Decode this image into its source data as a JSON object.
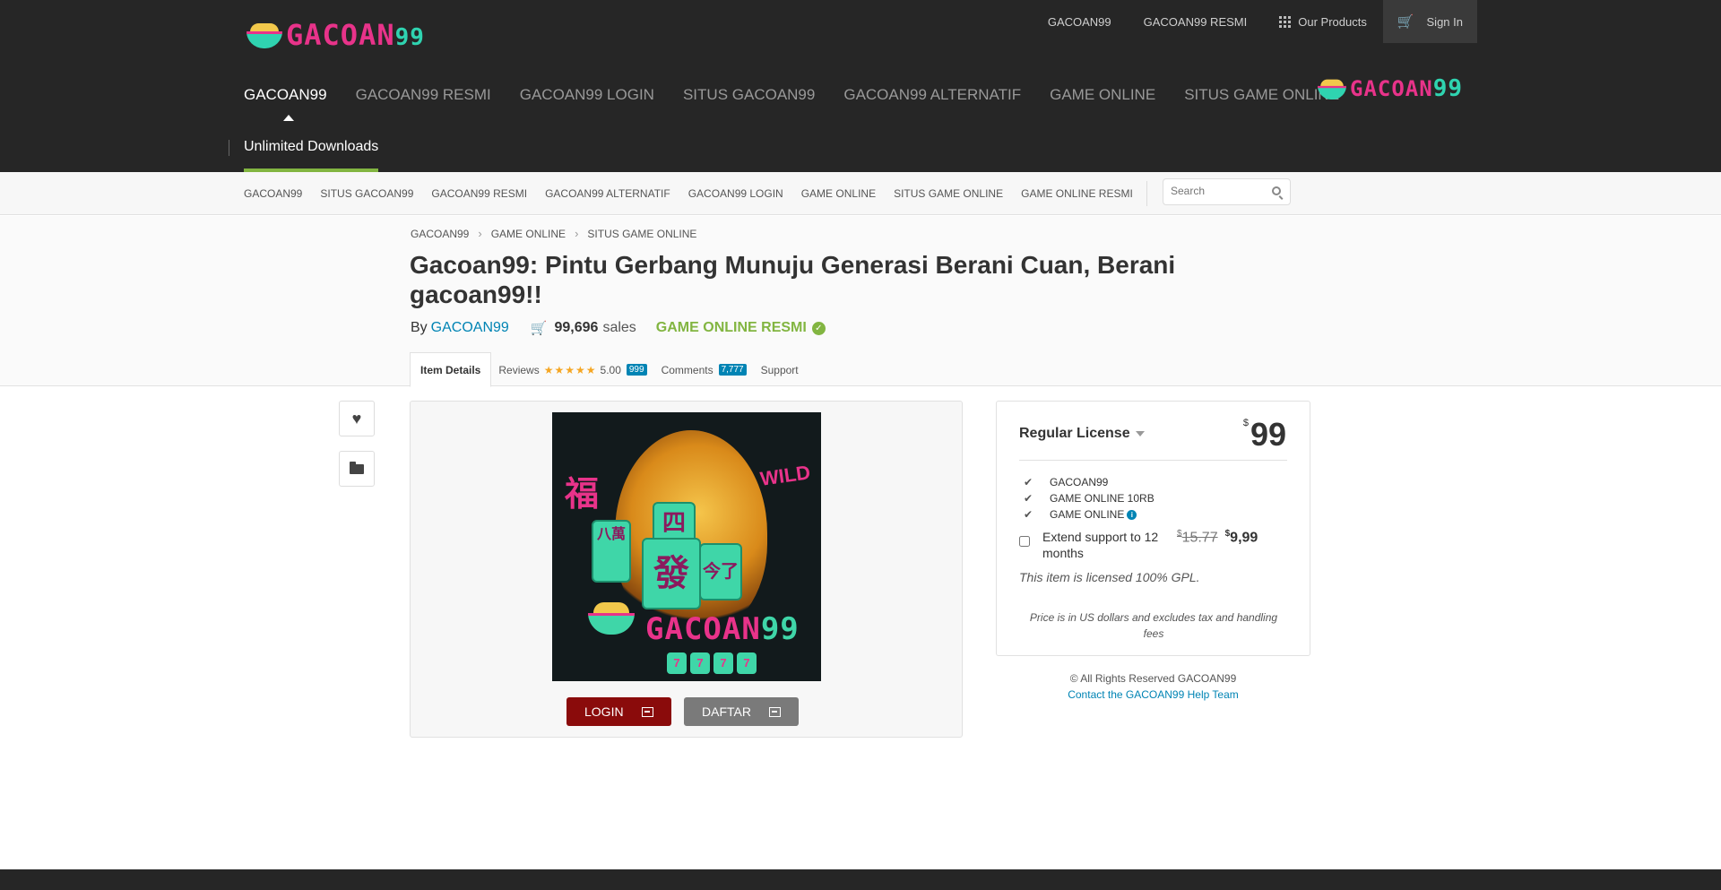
{
  "brand": {
    "logo_main": "GACOAN",
    "logo_num": "99",
    "accent": "#e8338a",
    "teal": "#2fd3b0",
    "green": "#82b541",
    "link_blue": "#0084b4"
  },
  "top_links": [
    "GACOAN99",
    "GACOAN99 RESMI",
    "Our Products",
    "Sign In"
  ],
  "top_icons": {
    "products": "grid-icon",
    "signin": "cart-icon"
  },
  "main_nav": [
    "GACOAN99",
    "GACOAN99 RESMI",
    "GACOAN99 LOGIN",
    "SITUS GACOAN99",
    "GACOAN99 ALTERNATIF",
    "GAME ONLINE",
    "SITUS GAME ONLINE"
  ],
  "unlimited": "Unlimited Downloads",
  "sub_nav": [
    "GACOAN99",
    "SITUS GACOAN99",
    "GACOAN99 RESMI",
    "GACOAN99 ALTERNATIF",
    "GACOAN99 LOGIN",
    "GAME ONLINE",
    "SITUS GAME ONLINE",
    "GAME ONLINE RESMI"
  ],
  "search": {
    "placeholder": "Search"
  },
  "breadcrumbs": [
    "GACOAN99",
    "GAME ONLINE",
    "SITUS GAME ONLINE"
  ],
  "item": {
    "title": "Gacoan99: Pintu Gerbang Munuju Generasi Berani Cuan, Berani gacoan99!!",
    "by": "By",
    "author": "GACOAN99",
    "sales_count": "99,696",
    "sales_word": "sales",
    "official": "GAME ONLINE RESMI"
  },
  "tabs": {
    "details": "Item Details",
    "reviews": "Reviews",
    "stars": "★★★★★",
    "rating": "5.00",
    "reviews_count": "999",
    "comments": "Comments",
    "comments_count": "7,777",
    "support": "Support"
  },
  "preview": {
    "art": {
      "glyph_left": "福",
      "wild": "WILD",
      "tile_center": "發",
      "tile_top": "四",
      "tile_right": "今了",
      "tile_left": "八萬",
      "reels": [
        "7",
        "7",
        "7",
        "7"
      ]
    },
    "login_label": "LOGIN",
    "daftar_label": "DAFTAR"
  },
  "license": {
    "title": "Regular License",
    "currency": "$",
    "price": "99",
    "features": [
      "GACOAN99",
      "GAME ONLINE 10RB",
      "GAME ONLINE"
    ],
    "extend_label": "Extend support to 12 months",
    "old_price": "15.77",
    "new_price": "9,99",
    "gpl": "This item is licensed 100% GPL.",
    "note": "Price is in US dollars and excludes tax and handling fees"
  },
  "rights": "© All Rights Reserved GACOAN99",
  "help_link": "Contact the GACOAN99 Help Team"
}
